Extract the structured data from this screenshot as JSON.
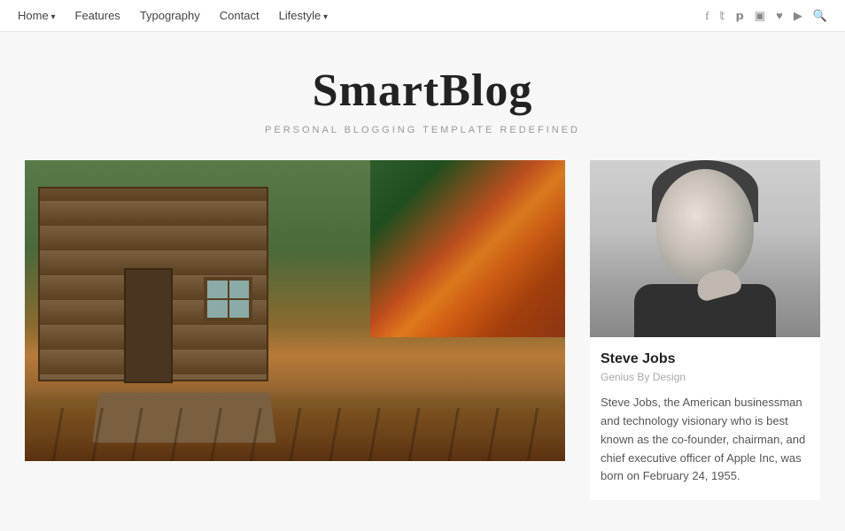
{
  "nav": {
    "items": [
      {
        "label": "Home",
        "hasArrow": true
      },
      {
        "label": "Features",
        "hasArrow": false
      },
      {
        "label": "Typography",
        "hasArrow": false
      },
      {
        "label": "Contact",
        "hasArrow": false
      },
      {
        "label": "Lifestyle",
        "hasArrow": true
      }
    ],
    "icons": [
      "f",
      "t",
      "p",
      "ig",
      "♥",
      "rss",
      "🔍"
    ]
  },
  "hero": {
    "title": "SmartBlog",
    "subtitle": "PERSONAL BLOGGING TEMPLATE REDEFINED"
  },
  "sidebar_post": {
    "name": "Steve Jobs",
    "tag": "Genius By Design",
    "description": "Steve Jobs, the American businessman and technology visionary who is best known as the co-founder, chairman, and chief executive officer of Apple Inc, was born on February 24, 1955."
  }
}
